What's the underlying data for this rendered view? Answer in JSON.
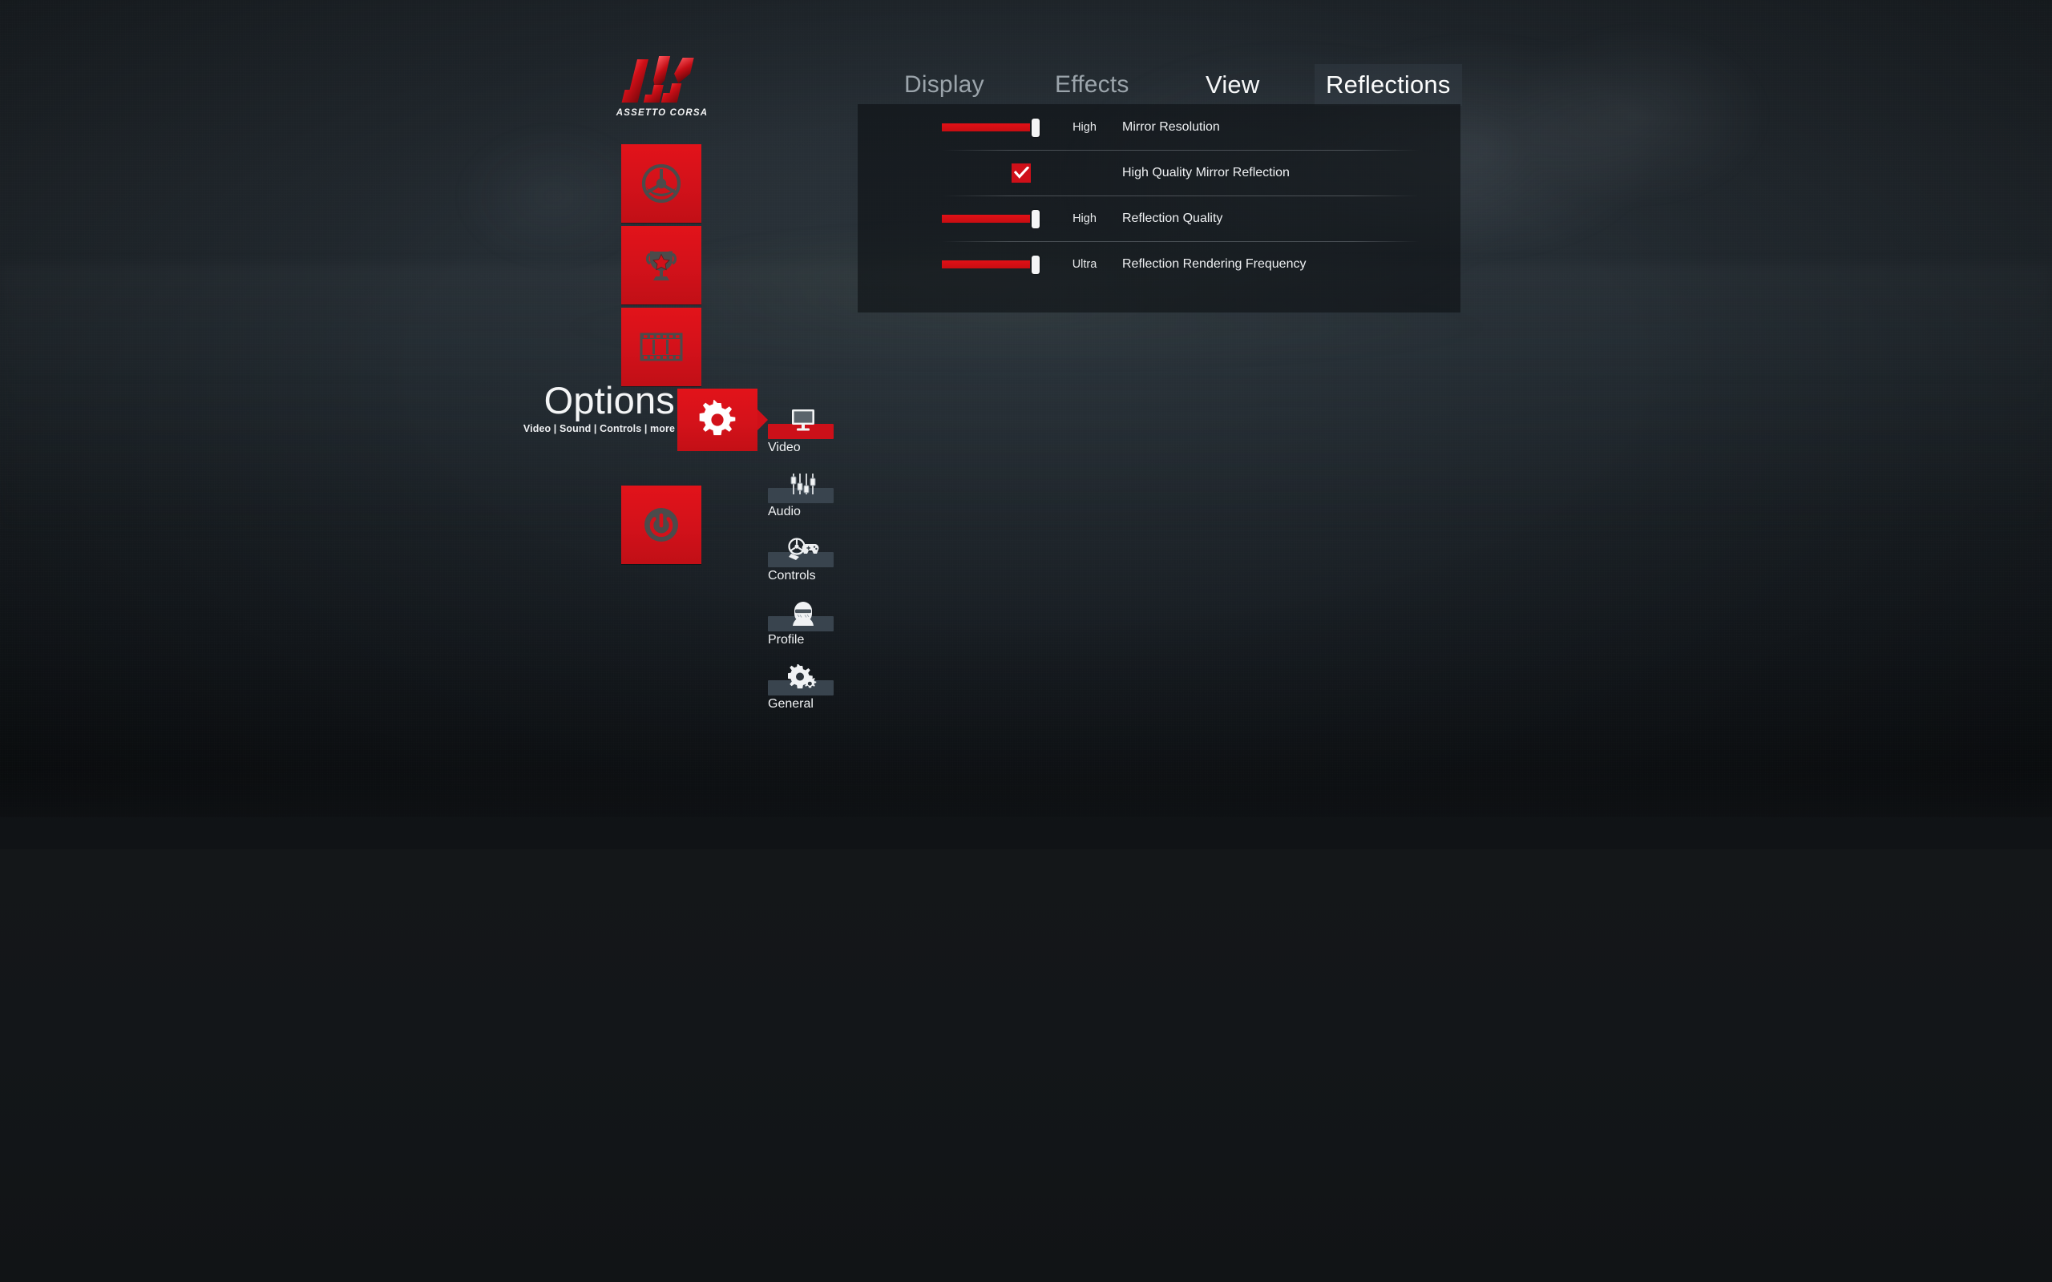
{
  "branding": {
    "logo_icon": "assetto-corsa-logo-icon",
    "wordmark": "ASSETTO CORSA"
  },
  "main_menu": {
    "items": [
      {
        "id": "drive",
        "icon": "steering-wheel-icon",
        "label": "Drive"
      },
      {
        "id": "career",
        "icon": "trophy-icon",
        "label": "Career"
      },
      {
        "id": "replay",
        "icon": "film-strip-icon",
        "label": "Replay"
      },
      {
        "id": "options",
        "icon": "gear-icon",
        "label": "Options",
        "active": true
      },
      {
        "id": "quit",
        "icon": "power-icon",
        "label": "Quit"
      }
    ]
  },
  "page_header": {
    "title": "Options",
    "subtitle": "Video | Sound | Controls | more",
    "icon": "gear-icon"
  },
  "submenu": {
    "items": [
      {
        "id": "video",
        "label": "Video",
        "icon": "monitor-icon",
        "active": true,
        "bar_color": "#cc1019"
      },
      {
        "id": "audio",
        "label": "Audio",
        "icon": "sliders-icon",
        "active": false,
        "bar_color": "#39444e"
      },
      {
        "id": "controls",
        "label": "Controls",
        "icon": "wheel-gamepad-icon",
        "active": false,
        "bar_color": "#39444e"
      },
      {
        "id": "profile",
        "label": "Profile",
        "icon": "driver-helmet-icon",
        "active": false,
        "bar_color": "#39444e"
      },
      {
        "id": "general",
        "label": "General",
        "icon": "gears-icon",
        "active": false,
        "bar_color": "#39444e"
      }
    ]
  },
  "tabs": [
    {
      "id": "display",
      "label": "Display",
      "state": "inactive"
    },
    {
      "id": "effects",
      "label": "Effects",
      "state": "inactive"
    },
    {
      "id": "view",
      "label": "View",
      "state": "hover"
    },
    {
      "id": "reflections",
      "label": "Reflections",
      "state": "active"
    }
  ],
  "settings": {
    "rows": [
      {
        "id": "mirror-resolution",
        "control": "slider",
        "value": "High",
        "label": "Mirror Resolution",
        "fill_percent": 89
      },
      {
        "id": "high-quality-mirror-reflection",
        "control": "checkbox",
        "value": "",
        "label": "High Quality Mirror Reflection",
        "checked": true
      },
      {
        "id": "reflection-quality",
        "control": "slider",
        "value": "High",
        "label": "Reflection Quality",
        "fill_percent": 89
      },
      {
        "id": "reflection-rendering-frequency",
        "control": "slider",
        "value": "Ultra",
        "label": "Reflection Rendering Frequency",
        "fill_percent": 89
      }
    ]
  },
  "colors": {
    "accent_red": "#cf1019",
    "panel_bg": "rgba(13,16,19,0.62)",
    "text_primary": "#f0f2f4",
    "text_inactive": "#9ba4ab",
    "bar_inactive": "#39444e"
  }
}
